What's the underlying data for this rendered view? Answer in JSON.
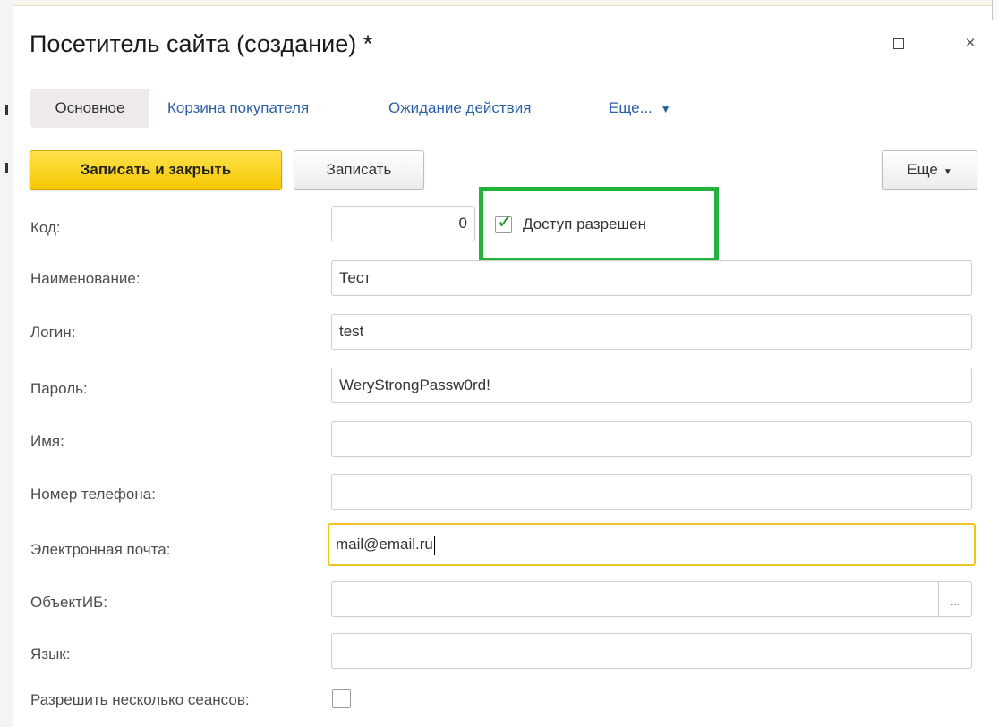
{
  "window": {
    "title": "Посетитель сайта (создание) *",
    "maximize_label": "□",
    "close_label": "×"
  },
  "tabs": [
    {
      "label": "Основное",
      "active": true
    },
    {
      "label": "Корзина покупателя",
      "active": false
    },
    {
      "label": "Ожидание действия",
      "active": false
    },
    {
      "label": "Еще...",
      "active": false
    }
  ],
  "toolbar": {
    "save_close_label": "Записать и закрыть",
    "save_label": "Записать",
    "more_label": "Еще"
  },
  "form": {
    "code": {
      "label": "Код:",
      "value": "0"
    },
    "access": {
      "label": "Доступ разрешен",
      "checked": true
    },
    "name": {
      "label": "Наименование:",
      "value": "Тест"
    },
    "login": {
      "label": "Логин:",
      "value": "test"
    },
    "password": {
      "label": "Пароль:",
      "value": "WeryStrongPassw0rd!"
    },
    "first_name": {
      "label": "Имя:",
      "value": ""
    },
    "phone": {
      "label": "Номер телефона:",
      "value": ""
    },
    "email": {
      "label": "Электронная почта:",
      "value": "mail@email.ru"
    },
    "ib_object": {
      "label": "ОбъектИБ:",
      "value": "",
      "button": "..."
    },
    "language": {
      "label": "Язык:",
      "value": ""
    },
    "multi_session": {
      "label": "Разрешить несколько сеансов:",
      "checked": false
    }
  },
  "colors": {
    "primary_button": "#f5c800",
    "highlight_border": "#22b43a",
    "focus_border": "#f0c420",
    "link": "#2b5fa8"
  }
}
